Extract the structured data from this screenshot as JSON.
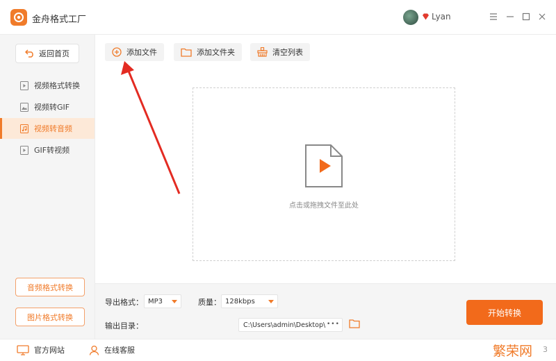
{
  "app": {
    "title": "金舟格式工厂",
    "username": "Lyan"
  },
  "colors": {
    "accent": "#f07b2a",
    "start_button": "#f26a1b",
    "active_nav_bg": "#fde9d8"
  },
  "sidebar": {
    "back_label": "返回首页",
    "items": [
      {
        "label": "视频格式转换",
        "icon": "video-file-icon",
        "active": false
      },
      {
        "label": "视频转GIF",
        "icon": "image-file-icon",
        "active": false
      },
      {
        "label": "视频转音频",
        "icon": "music-file-icon",
        "active": true
      },
      {
        "label": "GIF转视频",
        "icon": "video-file-icon",
        "active": false
      }
    ],
    "audio_convert_label": "音频格式转换",
    "image_convert_label": "图片格式转换"
  },
  "toolbar": {
    "add_file_label": "添加文件",
    "add_folder_label": "添加文件夹",
    "clear_list_label": "清空列表"
  },
  "dropzone": {
    "hint": "点击或拖拽文件至此处"
  },
  "output": {
    "format_label": "导出格式：",
    "format_value": "MP3",
    "quality_label": "质量：",
    "quality_value": "128kbps",
    "dir_label": "输出目录：",
    "dir_value": "C:\\Users\\admin\\Desktop\\",
    "more_label": "•••",
    "start_label": "开始转换"
  },
  "statusbar": {
    "website_label": "官方网站",
    "support_label": "在线客服",
    "watermark": "繁荣网",
    "corner_text": "3"
  }
}
